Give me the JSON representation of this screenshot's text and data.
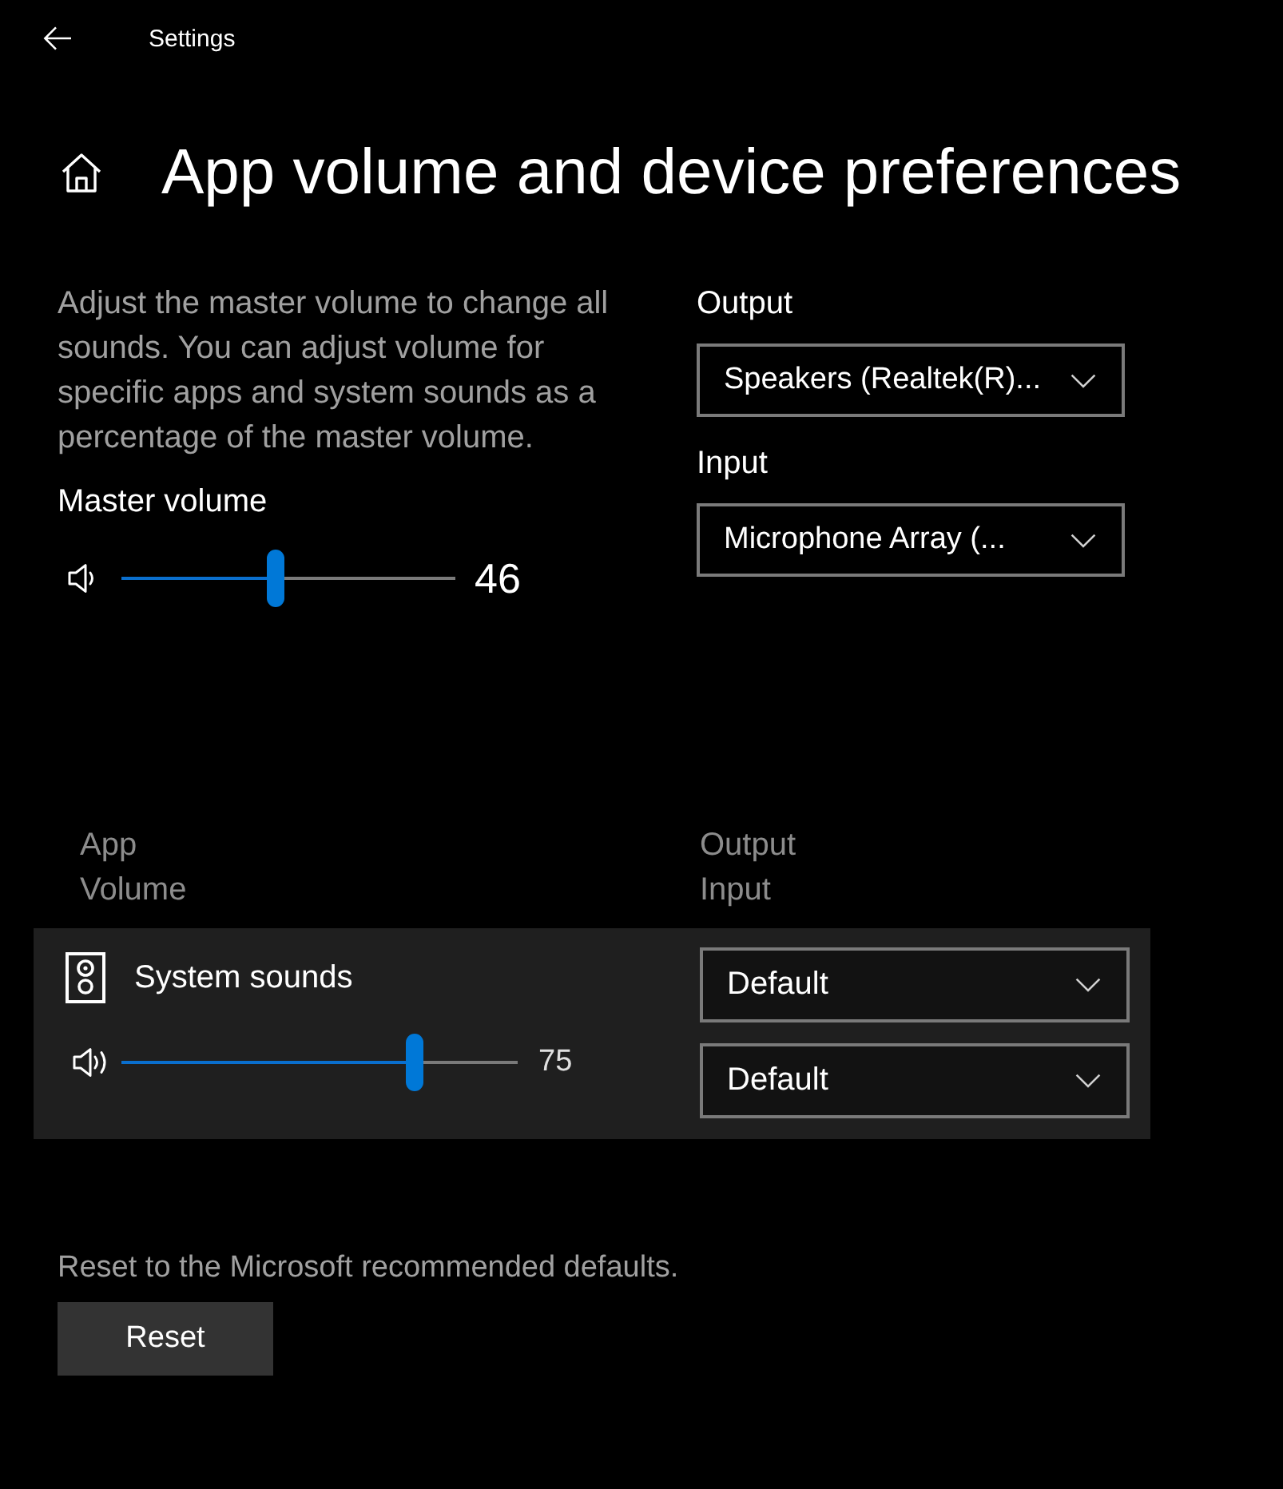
{
  "window": {
    "title": "Settings"
  },
  "page": {
    "title": "App volume and device preferences"
  },
  "master": {
    "description": "Adjust the master volume to change all sounds. You can adjust volume for specific apps and system sounds as a percentage of the master volume.",
    "label": "Master volume",
    "level": 0.46,
    "reading": "46"
  },
  "devices": [
    {
      "label": "Output",
      "value": "Speakers (Realtek(R)..."
    },
    {
      "label": "Input",
      "value": "Microphone Array (..."
    }
  ],
  "apps_table": {
    "columns": [
      {
        "title": "App",
        "subtitle": "Volume"
      },
      {
        "title": "Output",
        "subtitle": "Input"
      }
    ],
    "rows": [
      {
        "name": "System sounds",
        "level": 0.75,
        "reading": "75",
        "output": "Default",
        "input": "Default"
      }
    ]
  },
  "reset": {
    "text": "Reset to the Microsoft recommended defaults.",
    "button": "Reset"
  }
}
